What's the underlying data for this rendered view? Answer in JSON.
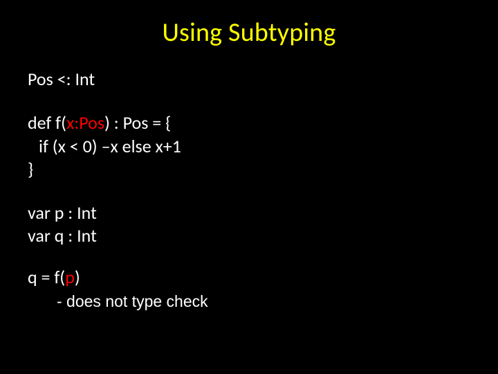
{
  "title": "Using Subtyping",
  "subtypeLine": "Pos <: Int",
  "def": {
    "l1a": "def f(",
    "l1b": "x:Pos",
    "l1c": ") : Pos = {",
    "l2": "if (x < 0) –x else x+1",
    "l3": "}"
  },
  "vars": {
    "p": "var p : Int",
    "q": "var q : Int"
  },
  "call": {
    "a": "q = f(",
    "b": "p",
    "c": ")"
  },
  "note": "- does not type check"
}
